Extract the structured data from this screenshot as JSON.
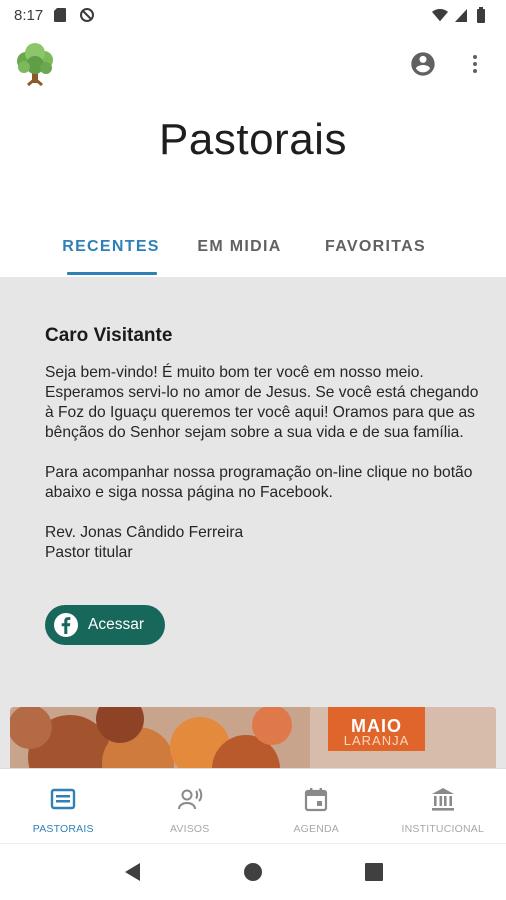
{
  "status_bar": {
    "time": "8:17",
    "icons": [
      "sd-card-icon",
      "data-saver-icon",
      "wifi-icon",
      "signal-icon",
      "battery-icon"
    ]
  },
  "app_bar": {
    "logo": "tree-logo-icon",
    "actions": [
      "account-circle-icon",
      "more-vert-icon"
    ]
  },
  "page": {
    "title": "Pastorais"
  },
  "tabs": [
    {
      "label": "RECENTES",
      "active": true
    },
    {
      "label": "EM MIDIA",
      "active": false
    },
    {
      "label": "FAVORITAS",
      "active": false
    }
  ],
  "card": {
    "title": "Caro Visitante",
    "paragraph_1": "Seja bem-vindo! É muito bom ter você em nosso meio. Esperamos servi-lo no amor de Jesus. Se você está chegando à Foz do Iguaçu queremos ter você aqui! Oramos para que as bênçãos do Senhor sejam sobre a sua vida e de sua família.",
    "paragraph_2": "Para acompanhar nossa programação on-line clique no botão abaixo e siga nossa página no Facebook.",
    "signature_name": "Rev. Jonas Cândido Ferreira",
    "signature_role": "Pastor titular",
    "button_label": "Acessar",
    "button_icon": "facebook-icon"
  },
  "banner": {
    "badge_main": "MAIO",
    "badge_sub": "LARANJA"
  },
  "bottom_nav": [
    {
      "label": "PASTORAIS",
      "icon": "newspaper-icon",
      "active": true
    },
    {
      "label": "AVISOS",
      "icon": "announcement-icon",
      "active": false
    },
    {
      "label": "AGENDA",
      "icon": "calendar-icon",
      "active": false
    },
    {
      "label": "INSTITUCIONAL",
      "icon": "institution-icon",
      "active": false
    }
  ],
  "system_nav": [
    "back-icon",
    "home-icon",
    "recents-icon"
  ],
  "colors": {
    "accent": "#2f80b8",
    "button": "#17675a",
    "content_bg": "#e6e6e6",
    "banner_orange": "#e0652a"
  }
}
